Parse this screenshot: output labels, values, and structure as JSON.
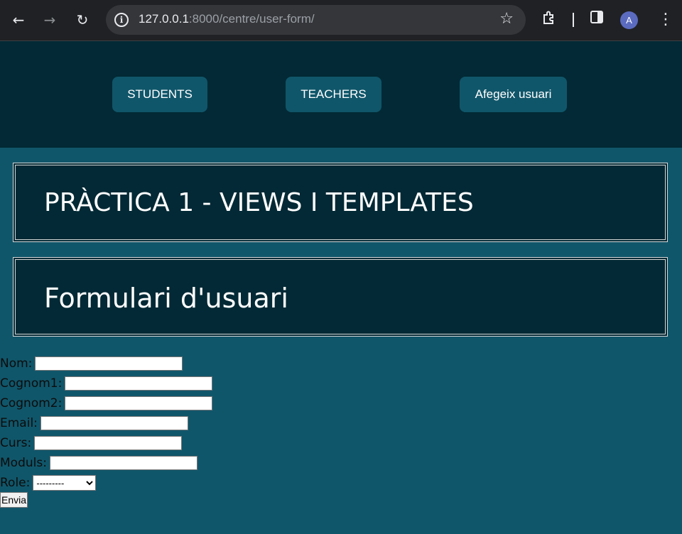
{
  "browser": {
    "url_host": "127.0.0.1",
    "url_rest": ":8000/centre/user-form/",
    "profile_initial": "A",
    "icons": [
      "back-arrow-icon",
      "forward-arrow-icon",
      "reload-icon",
      "site-info-icon",
      "bookmark-star-icon",
      "extensions-icon",
      "side-panel-icon",
      "menu-icon"
    ]
  },
  "header": {
    "nav": [
      {
        "label": "STUDENTS"
      },
      {
        "label": "TEACHERS"
      },
      {
        "label": "Afegeix usuari"
      }
    ]
  },
  "main": {
    "title": "PRÀCTICA 1 - VIEWS I TEMPLATES",
    "subtitle": "Formulari d'usuari"
  },
  "form": {
    "fields": [
      {
        "label": "Nom:",
        "value": ""
      },
      {
        "label": "Cognom1:",
        "value": ""
      },
      {
        "label": "Cognom2:",
        "value": ""
      },
      {
        "label": "Email:",
        "value": ""
      },
      {
        "label": "Curs:",
        "value": ""
      },
      {
        "label": "Moduls:",
        "value": ""
      }
    ],
    "role_label": "Role:",
    "role_selected": "---------",
    "submit_label": "Envia"
  },
  "colors": {
    "page_bg": "#10566a",
    "header_bg": "#022935",
    "button_bg": "#10566a"
  }
}
